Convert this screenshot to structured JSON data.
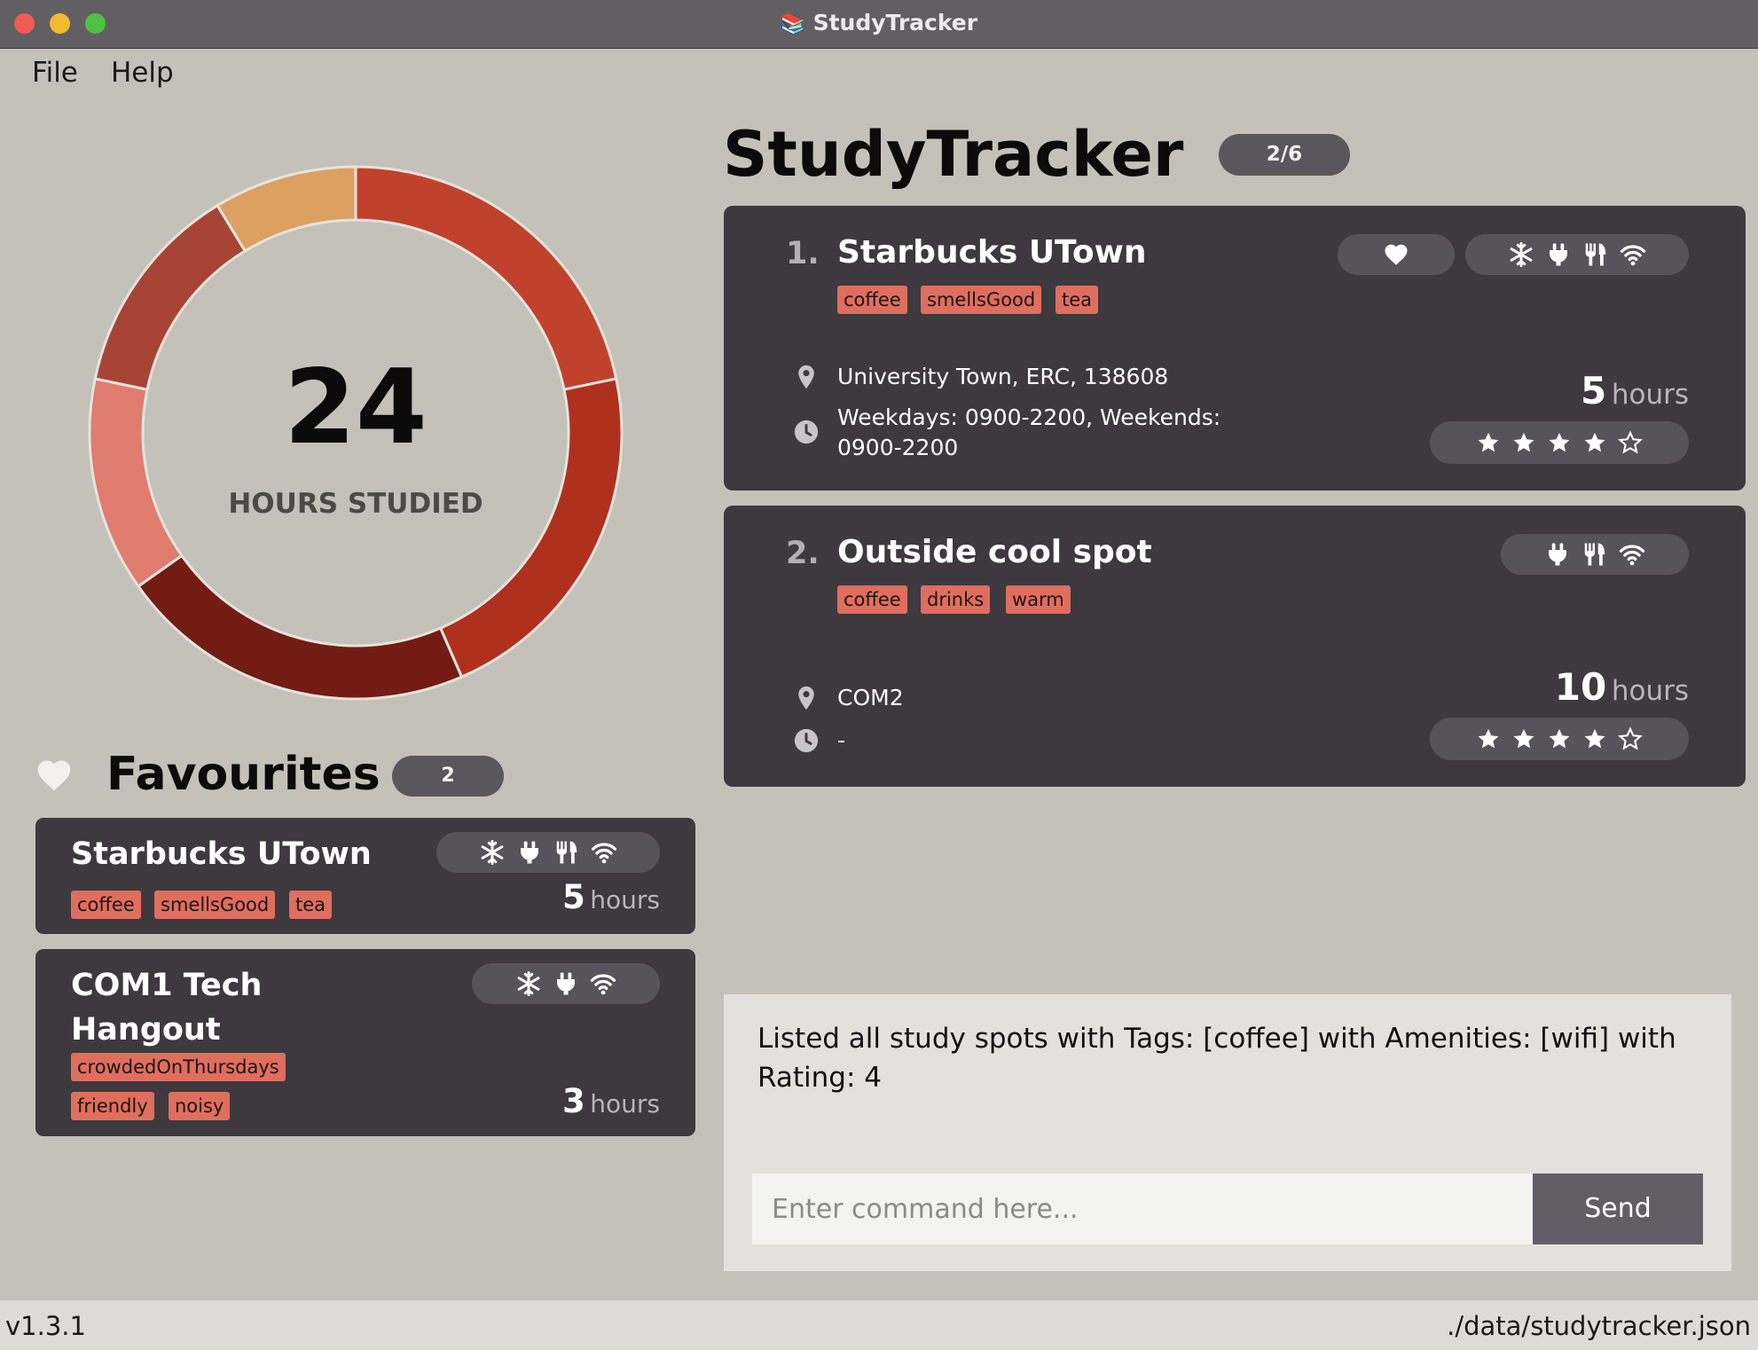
{
  "window": {
    "title": "StudyTracker"
  },
  "menu": {
    "file": "File",
    "help": "Help"
  },
  "summary": {
    "total_hours": "24",
    "label": "HOURS STUDIED",
    "segments": [
      {
        "value": 5,
        "color": "#c0422c"
      },
      {
        "value": 5,
        "color": "#b0301e"
      },
      {
        "value": 5,
        "color": "#731c14"
      },
      {
        "value": 3,
        "color": "#e07c70"
      },
      {
        "value": 3,
        "color": "#a84436"
      },
      {
        "value": 2,
        "color": "#dca060"
      }
    ]
  },
  "favourites": {
    "title": "Favourites",
    "count": "2",
    "items": [
      {
        "name": "Starbucks UTown",
        "tags": [
          "coffee",
          "smellsGood",
          "tea"
        ],
        "amenities": [
          "aircon-icon",
          "charger-icon",
          "food-icon",
          "wifi-icon"
        ],
        "hours": "5",
        "hours_unit": "hours"
      },
      {
        "name_line1": "COM1 Tech",
        "name_line2": "Hangout",
        "tags": [
          "crowdedOnThursdays",
          "friendly",
          "noisy"
        ],
        "amenities": [
          "aircon-icon",
          "charger-icon",
          "wifi-icon"
        ],
        "hours": "3",
        "hours_unit": "hours"
      }
    ]
  },
  "list": {
    "title": "StudyTracker",
    "count": "2/6",
    "spots": [
      {
        "index": "1.",
        "name": "Starbucks UTown",
        "favourite": true,
        "tags": [
          "coffee",
          "smellsGood",
          "tea"
        ],
        "amenities": [
          "aircon-icon",
          "charger-icon",
          "food-icon",
          "wifi-icon"
        ],
        "address": "University Town, ERC, 138608",
        "hours_line1": "Weekdays: 0900-2200, Weekends:",
        "hours_line2": "0900-2200",
        "studied": "5",
        "studied_unit": "hours",
        "rating": 4
      },
      {
        "index": "2.",
        "name": "Outside cool spot",
        "favourite": false,
        "tags": [
          "coffee",
          "drinks",
          "warm"
        ],
        "amenities": [
          "charger-icon",
          "food-icon",
          "wifi-icon"
        ],
        "address": "COM2",
        "hours_line1": "-",
        "studied": "10",
        "studied_unit": "hours",
        "rating": 4
      }
    ]
  },
  "result": {
    "text": "Listed all study spots with Tags: [coffee] with Amenities: [wifi] with Rating: 4"
  },
  "command": {
    "placeholder": "Enter command here...",
    "send_label": "Send"
  },
  "status": {
    "version": "v1.3.1",
    "path": "./data/studytracker.json"
  }
}
